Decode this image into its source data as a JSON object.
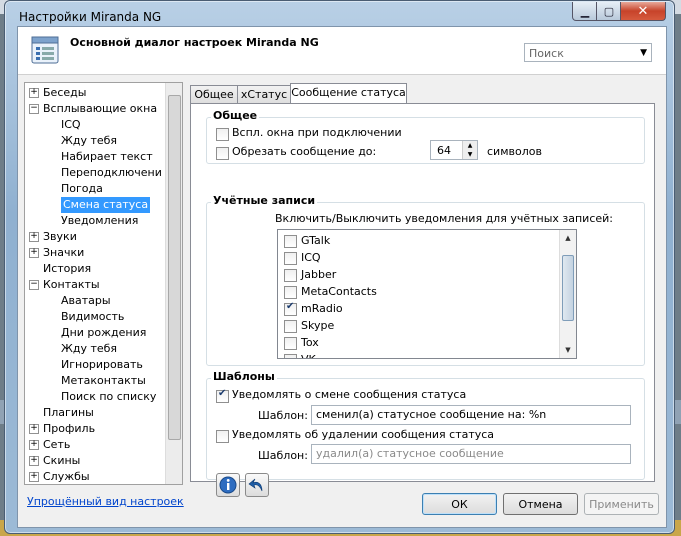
{
  "window": {
    "title": "Настройки Miranda NG"
  },
  "header": {
    "title": "Основной диалог настроек Miranda NG",
    "search_placeholder": "Поиск"
  },
  "tree": {
    "items": [
      {
        "label": "Беседы",
        "level": 0,
        "expander": "+"
      },
      {
        "label": "Всплывающие окна",
        "level": 0,
        "expander": "−"
      },
      {
        "label": "ICQ",
        "level": 1
      },
      {
        "label": "Жду тебя",
        "level": 1
      },
      {
        "label": "Набирает текст",
        "level": 1
      },
      {
        "label": "Переподключени",
        "level": 1
      },
      {
        "label": "Погода",
        "level": 1
      },
      {
        "label": "Смена статуса",
        "level": 1,
        "selected": true
      },
      {
        "label": "Уведомления",
        "level": 1
      },
      {
        "label": "Звуки",
        "level": 0,
        "expander": "+"
      },
      {
        "label": "Значки",
        "level": 0,
        "expander": "+"
      },
      {
        "label": "История",
        "level": 0
      },
      {
        "label": "Контакты",
        "level": 0,
        "expander": "−"
      },
      {
        "label": "Аватары",
        "level": 1
      },
      {
        "label": "Видимость",
        "level": 1
      },
      {
        "label": "Дни рождения",
        "level": 1
      },
      {
        "label": "Жду тебя",
        "level": 1
      },
      {
        "label": "Игнорировать",
        "level": 1
      },
      {
        "label": "Метаконтакты",
        "level": 1
      },
      {
        "label": "Поиск по списку",
        "level": 1
      },
      {
        "label": "Плагины",
        "level": 0
      },
      {
        "label": "Профиль",
        "level": 0,
        "expander": "+"
      },
      {
        "label": "Сеть",
        "level": 0,
        "expander": "+"
      },
      {
        "label": "Скины",
        "level": 0,
        "expander": "+"
      },
      {
        "label": "Службы",
        "level": 0,
        "expander": "+"
      }
    ]
  },
  "simple_view_link": "Упрощённый вид настроек",
  "tabs": [
    {
      "label": "Общее"
    },
    {
      "label": "xСтатус"
    },
    {
      "label": "Сообщение статуса",
      "active": true
    }
  ],
  "general": {
    "title": "Общее",
    "popup_on_connect": "Вспл. окна при подключении",
    "truncate_label": "Обрезать сообщение до:",
    "truncate_value": "64",
    "truncate_unit": "символов"
  },
  "accounts": {
    "title": "Учётные записи",
    "hint": "Включить/Выключить уведомления для учётных записей:",
    "items": [
      {
        "label": "GTalk",
        "checked": false
      },
      {
        "label": "ICQ",
        "checked": false
      },
      {
        "label": "Jabber",
        "checked": false
      },
      {
        "label": "MetaContacts",
        "checked": false
      },
      {
        "label": "mRadio",
        "checked": true
      },
      {
        "label": "Skype",
        "checked": false
      },
      {
        "label": "Tox",
        "checked": false
      },
      {
        "label": "VK",
        "checked": false
      }
    ]
  },
  "templates": {
    "title": "Шаблоны",
    "notify_change_label": "Уведомлять о смене сообщения статуса",
    "template_label": "Шаблон:",
    "change_template_value": "сменил(а) статусное сообщение на: %n",
    "notify_remove_label": "Уведомлять об удалении сообщения статуса",
    "remove_template_placeholder": "удалил(а) статусное сообщение"
  },
  "buttons": {
    "ok": "ОК",
    "cancel": "Отмена",
    "apply": "Применить"
  }
}
